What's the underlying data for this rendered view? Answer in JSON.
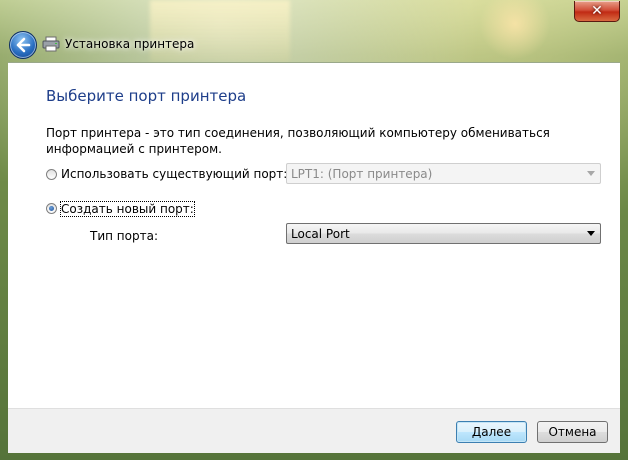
{
  "window": {
    "title": "Установка принтера",
    "close_glyph": "✕"
  },
  "page": {
    "heading": "Выберите порт принтера",
    "description": "Порт принтера - это тип соединения, позволяющий компьютеру обмениваться информацией с принтером."
  },
  "options": {
    "existing_port": {
      "label": "Использовать существующий порт:",
      "selected": false,
      "value": "LPT1: (Порт принтера)"
    },
    "new_port": {
      "label": "Создать новый порт:",
      "selected": true,
      "type_label": "Тип порта:",
      "type_value": "Local Port"
    }
  },
  "footer": {
    "next_label": "Далее",
    "cancel_label": "Отмена"
  },
  "icons": [
    "back-arrow-icon",
    "printer-icon",
    "close-icon",
    "chevron-down-icon"
  ]
}
